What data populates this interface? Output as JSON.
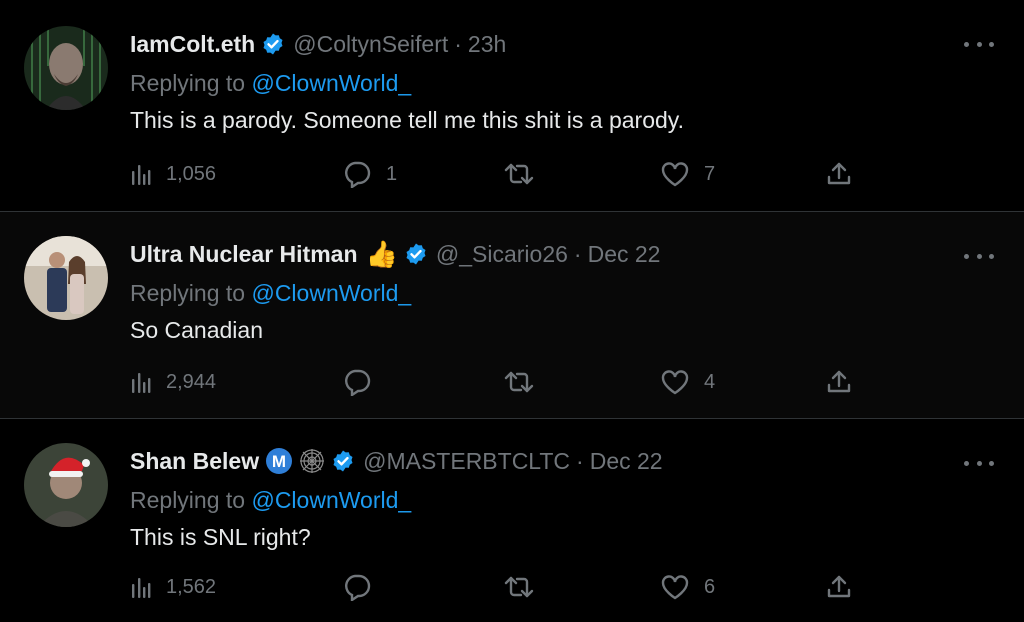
{
  "colors": {
    "background": "#000000",
    "text": "#e7e9ea",
    "muted": "#71767b",
    "link": "#1d9bf0",
    "verified": "#1d9bf0",
    "divider": "#2f3336"
  },
  "tweets": [
    {
      "name": "IamColt.eth",
      "handle": "@ColtynSeifert",
      "separator": "·",
      "time": "23h",
      "replying_label": "Replying to",
      "replying_to": "@ClownWorld_",
      "text": "This is a parody. Someone tell me this shit is a parody.",
      "views": "1,056",
      "replies": "1",
      "retweets": "",
      "likes": "7",
      "icons": [
        "verified-icon",
        "views-icon",
        "reply-icon",
        "retweet-icon",
        "like-icon",
        "share-icon",
        "more-icon"
      ]
    },
    {
      "name": "Ultra Nuclear Hitman",
      "emoji": "👍",
      "handle": "@_Sicario26",
      "separator": "·",
      "time": "Dec 22",
      "replying_label": "Replying to",
      "replying_to": "@ClownWorld_",
      "text": "So Canadian",
      "views": "2,944",
      "replies": "",
      "retweets": "",
      "likes": "4",
      "icons": [
        "thumbs-up-emoji",
        "verified-icon",
        "views-icon",
        "reply-icon",
        "retweet-icon",
        "like-icon",
        "share-icon",
        "more-icon"
      ]
    },
    {
      "name": "Shan Belew",
      "badge_letter": "M",
      "handle": "@MASTERBTCLTC",
      "separator": "·",
      "time": "Dec 22",
      "replying_label": "Replying to",
      "replying_to": "@ClownWorld_",
      "text": "This is SNL right?",
      "views": "1,562",
      "replies": "",
      "retweets": "",
      "likes": "6",
      "icons": [
        "m-badge-icon",
        "spiderweb-icon",
        "verified-icon",
        "views-icon",
        "reply-icon",
        "retweet-icon",
        "like-icon",
        "share-icon",
        "more-icon"
      ]
    }
  ]
}
